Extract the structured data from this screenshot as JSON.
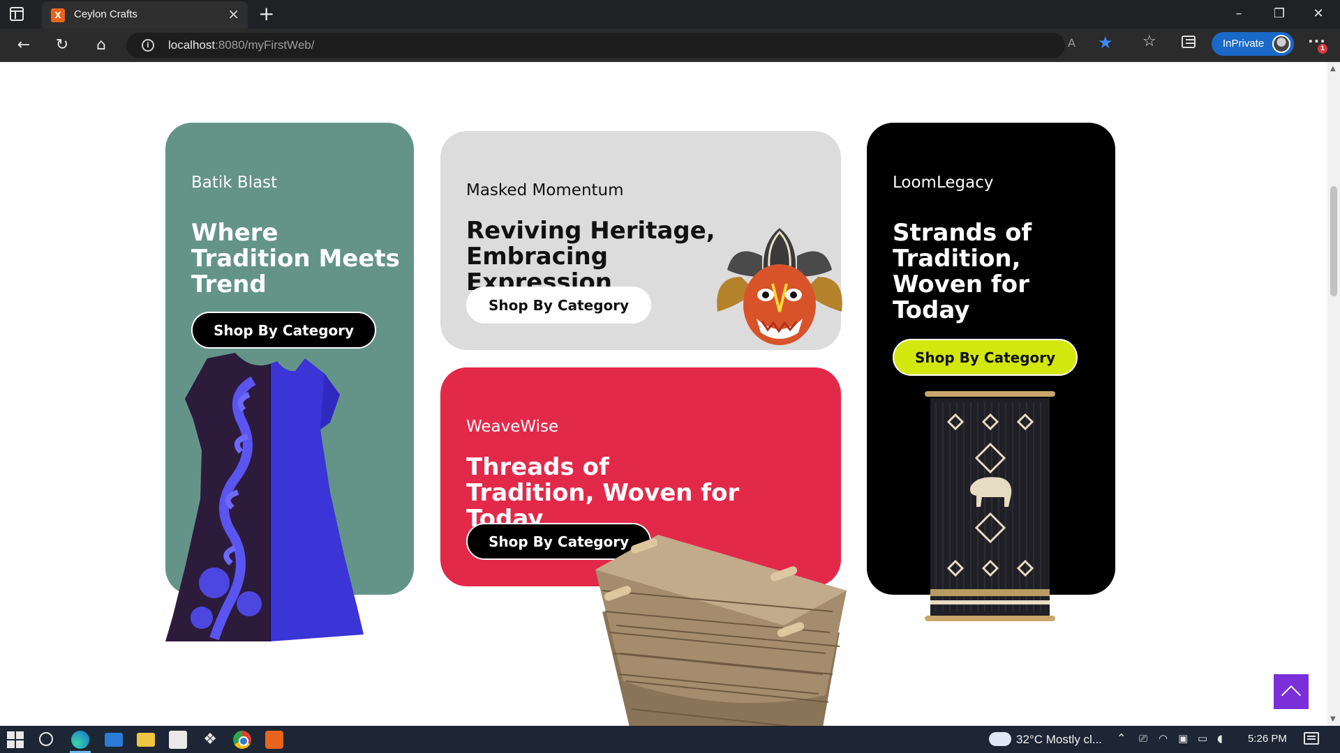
{
  "browser": {
    "tab_title": "Ceylon Crafts",
    "tab_favicon_text": "X",
    "new_tab_symbol": "+",
    "url_host": "localhost",
    "url_rest": ":8080/myFirstWeb/",
    "inprivate_label": "InPrivate",
    "alert_count": "1",
    "icons": [
      "tab-actions-icon",
      "close-icon",
      "back-arrow-icon",
      "refresh-icon",
      "home-icon",
      "info-icon",
      "read-aloud-icon",
      "favorite-star-icon",
      "favorites-icon",
      "collections-icon",
      "more-icon"
    ]
  },
  "cards": [
    {
      "name": "Batik Blast",
      "heading": "Where Tradition Meets Trend",
      "button": "Shop By Category",
      "bg_color": "#649488",
      "button_color": "#000000",
      "image": "batik-dress"
    },
    {
      "name": "Masked Momentum",
      "heading": "Reviving Heritage, Embracing Expression",
      "button": "Shop By Category",
      "bg_color": "#dcdcdc",
      "button_color": "#ffffff",
      "image": "raksha-mask"
    },
    {
      "name": "WeaveWise",
      "heading": "Threads of Tradition, Woven for Today",
      "button": "Shop By Category",
      "bg_color": "#e3294a",
      "button_color": "#000000",
      "image": "woven-baskets"
    },
    {
      "name": "LoomLegacy",
      "heading": "Strands of Tradition, Woven for Today",
      "button": "Shop By Category",
      "bg_color": "#000000",
      "button_color": "#d2e70d",
      "image": "woven-wall-hanging"
    }
  ],
  "back_to_top_color": "#7a2fd8",
  "taskbar": {
    "weather": "32°C  Mostly cl...",
    "clock": "5:26 PM",
    "apps": [
      "start-icon",
      "search-icon",
      "edge-icon",
      "mail-icon",
      "file-explorer-icon",
      "store-icon",
      "dropbox-icon",
      "chrome-icon",
      "xampp-icon"
    ]
  }
}
